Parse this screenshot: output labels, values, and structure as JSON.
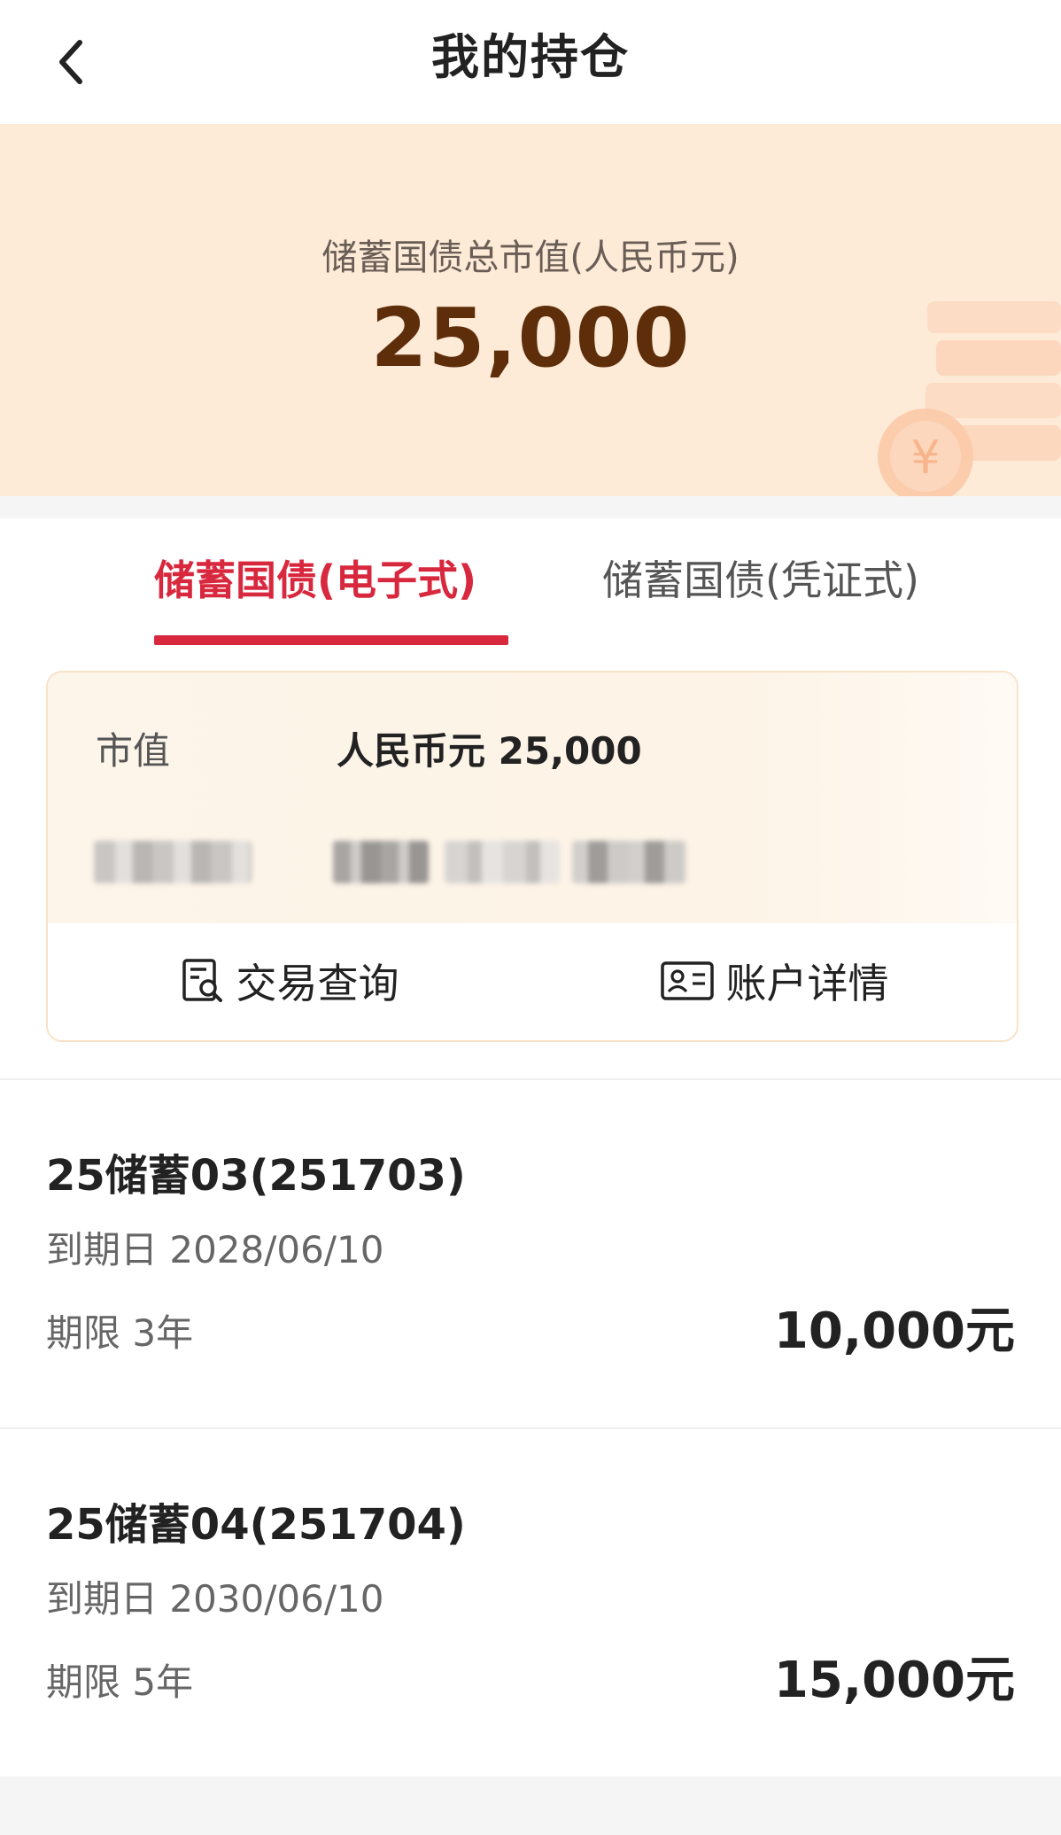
{
  "header": {
    "title": "我的持仓",
    "back_icon": "chevron-left-icon"
  },
  "summary": {
    "label": "储蓄国债总市值(人民币元)",
    "value": "25,000",
    "decoration_icon": "yuan-coin-icon"
  },
  "tabs": [
    {
      "label": "储蓄国债(电子式)",
      "active": true
    },
    {
      "label": "储蓄国债(凭证式)",
      "active": false
    }
  ],
  "account_card": {
    "market_value_label": "市值",
    "market_value": "人民币元 25,000",
    "actions": [
      {
        "label": "交易查询",
        "icon": "search-document-icon"
      },
      {
        "label": "账户详情",
        "icon": "id-card-icon"
      }
    ]
  },
  "bonds": [
    {
      "name": "25储蓄03(251703)",
      "maturity": "到期日 2028/06/10",
      "term": "期限 3年",
      "amount": "10,000元"
    },
    {
      "name": "25储蓄04(251704)",
      "maturity": "到期日 2030/06/10",
      "term": "期限 5年",
      "amount": "15,000元"
    }
  ],
  "colors": {
    "accent": "#d8283e",
    "summary_bg": "#fdebd8",
    "summary_value": "#5e2e0a"
  }
}
